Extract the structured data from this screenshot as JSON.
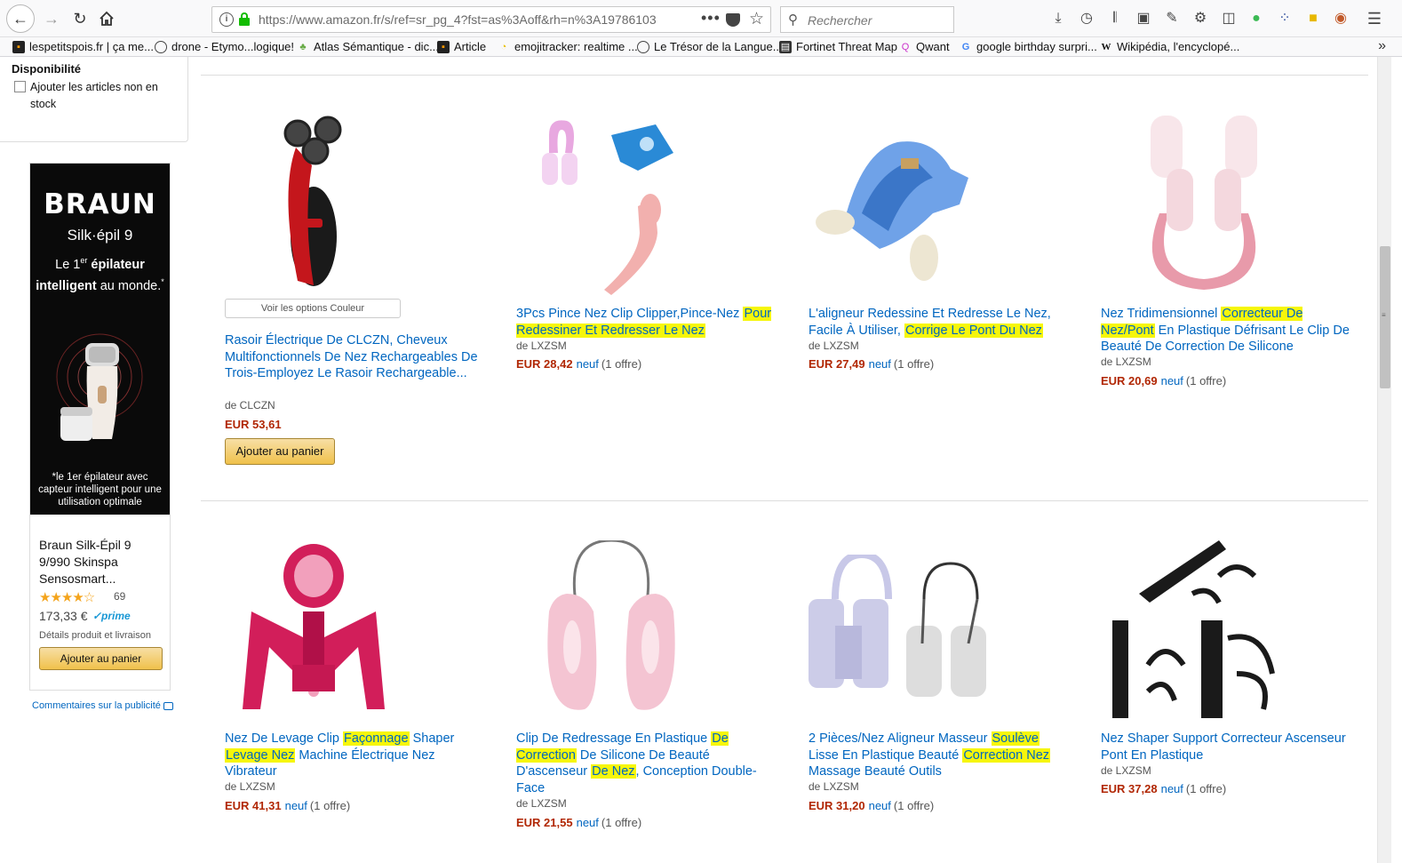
{
  "browser": {
    "url": "https://www.amazon.fr/s/ref=sr_pg_4?fst=as%3Aoff&rh=n%3A19786103",
    "search_placeholder": "Rechercher",
    "bookmarks": [
      "lespetitspois.fr | ça me...",
      "drone - Etymo...logique!",
      "Atlas Sémantique - dic...",
      "Article",
      "emojitracker: realtime ...",
      "Le Trésor de la Langue...",
      "Fortinet Threat Map",
      "Qwant",
      "google birthday surpri...",
      "Wikipédia, l'encyclopé..."
    ]
  },
  "filters": {
    "section_title": "Disponibilité",
    "include_out_of_stock_label": "Ajouter les articles non en stock"
  },
  "ad": {
    "brand": "BRAUN",
    "model": "Silk·épil 9",
    "tagline_part1": "Le 1",
    "tagline_sup": "er",
    "tagline_part2": " épilateur",
    "tagline_part3": "intelligent",
    "tagline_part4": " au monde.",
    "tagline_star": "*",
    "footnote": "*le 1er épilateur avec capteur intelligent pour une utilisation optimale",
    "product_title": "Braun Silk-Épil 9 9/990 Skinspa Sensosmart...",
    "stars": "★★★★☆",
    "rating": 4,
    "review_count": "69",
    "price": "173,33 €",
    "prime": "✓prime",
    "details_link": "Détails produit et livraison",
    "cart_label": "Ajouter au panier",
    "feedback_label": "Commentaires sur la publicité"
  },
  "results": [
    {
      "title_segments": [
        {
          "t": "Rasoir Électrique De CLCZN, Cheveux Multifonctionnels De Nez Rechargeables De Trois-Employez Le Rasoir Rechargeable...",
          "h": false
        }
      ],
      "brand": "de CLCZN",
      "price": "EUR 53,61",
      "condition": "",
      "offers": "",
      "options_label": "Voir les options Couleur",
      "cart_label": "Ajouter au panier"
    },
    {
      "title_segments": [
        {
          "t": "3Pcs Pince Nez Clip Clipper,Pince-Nez ",
          "h": false
        },
        {
          "t": "Pour Redessiner Et Redresser Le Nez",
          "h": true
        }
      ],
      "brand": "de LXZSM",
      "price": "EUR 28,42",
      "condition": "neuf",
      "offers": "(1 offre)"
    },
    {
      "title_segments": [
        {
          "t": "L'aligneur Redessine Et Redresse Le Nez, Facile À Utiliser, ",
          "h": false
        },
        {
          "t": "Corrige Le Pont Du Nez",
          "h": true
        }
      ],
      "brand": "de LXZSM",
      "price": "EUR 27,49",
      "condition": "neuf",
      "offers": "(1 offre)"
    },
    {
      "title_segments": [
        {
          "t": "Nez Tridimensionnel ",
          "h": false
        },
        {
          "t": "Correcteur De Nez/Pont",
          "h": true
        },
        {
          "t": " En Plastique Défrisant Le Clip De Beauté De Correction De Silicone",
          "h": false
        }
      ],
      "brand": "de LXZSM",
      "price": "EUR 20,69",
      "condition": "neuf",
      "offers": "(1 offre)"
    },
    {
      "title_segments": [
        {
          "t": "Nez De Levage Clip ",
          "h": false
        },
        {
          "t": "Façonnage",
          "h": true
        },
        {
          "t": " Shaper ",
          "h": false
        },
        {
          "t": "Levage Nez",
          "h": true
        },
        {
          "t": " Machine Électrique Nez Vibrateur",
          "h": false
        }
      ],
      "brand": "de LXZSM",
      "price": "EUR 41,31",
      "condition": "neuf",
      "offers": "(1 offre)"
    },
    {
      "title_segments": [
        {
          "t": "Clip De Redressage En Plastique ",
          "h": false
        },
        {
          "t": "De Correction",
          "h": true
        },
        {
          "t": " De Silicone De Beauté D'ascenseur ",
          "h": false
        },
        {
          "t": "De Nez",
          "h": true
        },
        {
          "t": ", Conception Double-Face",
          "h": false
        }
      ],
      "brand": "de LXZSM",
      "price": "EUR 21,55",
      "condition": "neuf",
      "offers": "(1 offre)"
    },
    {
      "title_segments": [
        {
          "t": "2 Pièces/Nez Aligneur Masseur ",
          "h": false
        },
        {
          "t": "Soulève",
          "h": true
        },
        {
          "t": " Lisse En Plastique Beauté ",
          "h": false
        },
        {
          "t": "Correction Nez",
          "h": true
        },
        {
          "t": " Massage Beauté Outils",
          "h": false
        }
      ],
      "brand": "de LXZSM",
      "price": "EUR 31,20",
      "condition": "neuf",
      "offers": "(1 offre)"
    },
    {
      "title_segments": [
        {
          "t": "Nez Shaper Support Correcteur Ascenseur Pont En Plastique",
          "h": false
        }
      ],
      "brand": "de LXZSM",
      "price": "EUR 37,28",
      "condition": "neuf",
      "offers": "(1 offre)"
    }
  ],
  "colors": {
    "link": "#0066c0",
    "price": "#b12704",
    "highlight": "#f6f60a",
    "button": "#f0c14b"
  }
}
